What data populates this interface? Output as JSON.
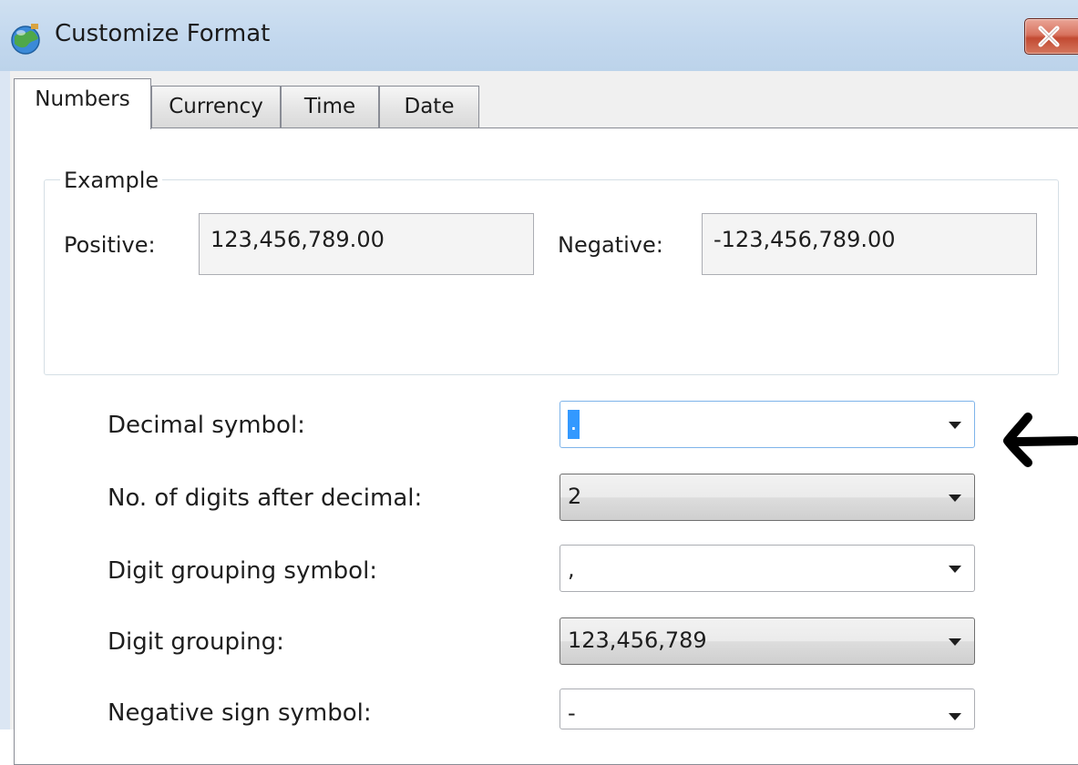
{
  "window": {
    "title": "Customize Format",
    "close_label": "X"
  },
  "tabs": [
    {
      "label": "Numbers",
      "active": true
    },
    {
      "label": "Currency",
      "active": false
    },
    {
      "label": "Time",
      "active": false
    },
    {
      "label": "Date",
      "active": false
    }
  ],
  "example": {
    "legend": "Example",
    "positive_label": "Positive:",
    "positive_value": "123,456,789.00",
    "negative_label": "Negative:",
    "negative_value": "-123,456,789.00"
  },
  "settings": [
    {
      "label": "Decimal symbol:",
      "value": ".",
      "style": "editable",
      "focused": true
    },
    {
      "label": "No. of digits after decimal:",
      "value": "2",
      "style": "dropdown"
    },
    {
      "label": "Digit grouping symbol:",
      "value": ",",
      "style": "editable"
    },
    {
      "label": "Digit grouping:",
      "value": "123,456,789",
      "style": "dropdown"
    },
    {
      "label": "Negative sign symbol:",
      "value": "-",
      "style": "editable"
    }
  ],
  "icons": {
    "app": "globe-icon",
    "close": "close-icon",
    "combo_arrow": "chevron-down-icon",
    "annotation": "arrow-left-icon"
  },
  "colors": {
    "titlebar": "#c3d8ee",
    "close_button": "#c24a32",
    "selection": "#3399ff",
    "focus_border": "#7eb4ea"
  }
}
